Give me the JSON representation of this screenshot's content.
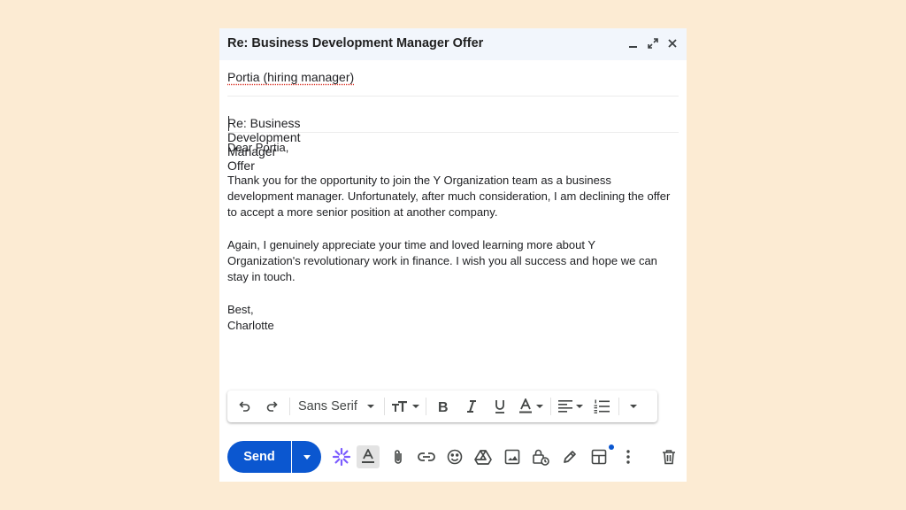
{
  "compose": {
    "title": "Re: Business Development Manager Offer",
    "to": "Portia (hiring manager)",
    "subject": "Re: Business Development Manager Offer",
    "body": {
      "greeting": "Dear Portia,",
      "paragraph1": "Thank you for the opportunity to join the Y Organization team as a business\ndevelopment manager. Unfortunately, after much consideration, I am declining the offer\nto accept a more senior position at another company.",
      "paragraph2": "Again, I genuinely appreciate your time and loved learning more about Y\nOrganization's revolutionary work in finance. I wish you all success and hope we can\nstay in touch.",
      "signoff": "Best,\nCharlotte"
    }
  },
  "format_toolbar": {
    "font": "Sans Serif"
  },
  "bottom_bar": {
    "send_label": "Send"
  },
  "colors": {
    "background": "#fcebd3",
    "accent": "#0b57d0",
    "titlebar": "#f2f6fc",
    "gemini": "#7b5cff"
  },
  "icons": [
    "minimize-icon",
    "fullscreen-icon",
    "close-icon",
    "undo-icon",
    "redo-icon",
    "text-size-icon",
    "bold-icon",
    "italic-icon",
    "underline-icon",
    "text-color-icon",
    "align-icon",
    "numbered-list-icon",
    "more-formatting-icon",
    "gemini-icon",
    "formatting-icon",
    "attach-icon",
    "link-icon",
    "emoji-icon",
    "drive-icon",
    "photo-icon",
    "confidential-icon",
    "signature-icon",
    "template-icon",
    "more-options-icon",
    "trash-icon"
  ]
}
